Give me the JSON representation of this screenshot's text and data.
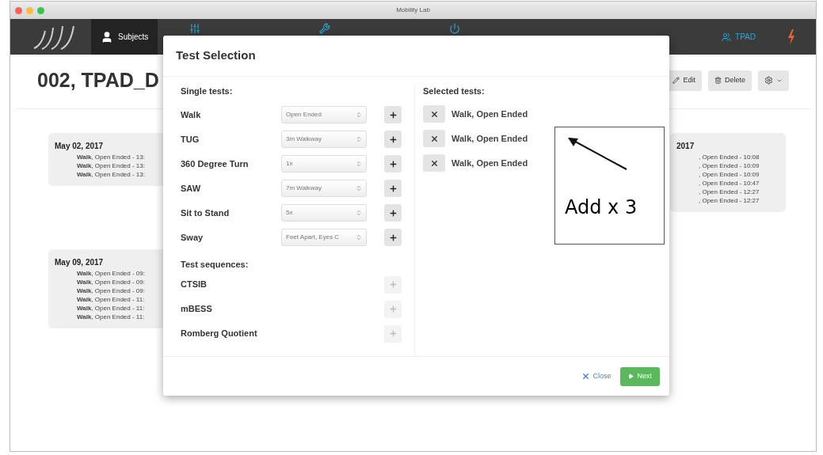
{
  "window": {
    "title": "Mobility Lab"
  },
  "nav": {
    "items": [
      {
        "label": "Subjects",
        "selected": true
      }
    ],
    "user": "TPAD"
  },
  "subject": {
    "title": "002, TPAD_D",
    "actions": [
      {
        "kind": "edit",
        "label": "Edit"
      },
      {
        "kind": "delete",
        "label": "Delete"
      },
      {
        "kind": "settings"
      }
    ]
  },
  "sessions_left": [
    {
      "date": "May 02, 2017",
      "entries": [
        "**Walk**, Open Ended - 13:",
        "**Walk**, Open Ended - 13:",
        "**Walk**, Open Ended - 13:"
      ]
    },
    {
      "date": "May 09, 2017",
      "entries": [
        "**Walk**, Open Ended - 09:",
        "**Walk**, Open Ended - 09:",
        "**Walk**, Open Ended - 09:",
        "**Walk**, Open Ended - 11:",
        "**Walk**, Open Ended - 11:",
        "**Walk**, Open Ended - 11:"
      ]
    }
  ],
  "sessions_right": [
    {
      "date": "2017",
      "entries": [
        ", Open Ended - 10:08",
        ", Open Ended - 10:09",
        ", Open Ended - 10:09",
        ", Open Ended - 10:47",
        ", Open Ended - 12:27",
        ", Open Ended - 12:27"
      ]
    }
  ],
  "modal": {
    "title": "Test Selection",
    "single_tests_heading": "Single tests:",
    "single_tests": [
      {
        "name": "Walk",
        "option": "Open Ended",
        "disabled": false
      },
      {
        "name": "TUG",
        "option": "3m Walkway",
        "disabled": false
      },
      {
        "name": "360 Degree Turn",
        "option": "1x",
        "disabled": false
      },
      {
        "name": "SAW",
        "option": "7m Walkway",
        "disabled": false
      },
      {
        "name": "Sit to Stand",
        "option": "5x",
        "disabled": false
      },
      {
        "name": "Sway",
        "option": "Feet Apart, Eyes C",
        "disabled": false
      }
    ],
    "sequences_heading": "Test sequences:",
    "sequences": [
      {
        "name": "CTSIB",
        "disabled": true
      },
      {
        "name": "mBESS",
        "disabled": true
      },
      {
        "name": "Romberg Quotient",
        "disabled": true
      }
    ],
    "selected_heading": "Selected tests:",
    "selected": [
      "Walk, Open Ended",
      "Walk, Open Ended",
      "Walk, Open Ended"
    ],
    "close": "Close",
    "next": "Next"
  },
  "annotation": {
    "text": "Add x 3"
  }
}
